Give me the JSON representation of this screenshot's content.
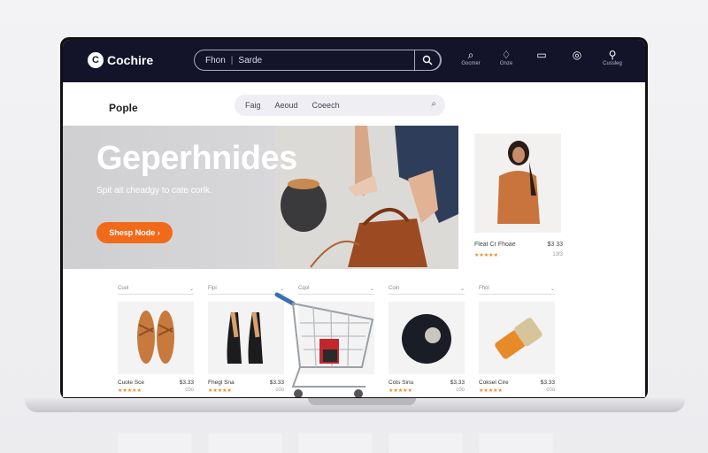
{
  "topbar": {
    "logo_text": "Cochire",
    "search_left": "Fhon",
    "search_right": "Sarde",
    "icons": [
      {
        "glyph": "⌕",
        "label": "Gocmer",
        "name": "search-icon"
      },
      {
        "glyph": "♢",
        "label": "Gnze",
        "name": "wishlist-icon"
      },
      {
        "glyph": "▭",
        "label": "",
        "name": "cart-icon"
      },
      {
        "glyph": "◎",
        "label": "",
        "name": "account-icon"
      },
      {
        "glyph": "⚲",
        "label": "Cussleg",
        "name": "profile-icon"
      }
    ]
  },
  "subhead": {
    "brand": "Pople",
    "nav": [
      "Faig",
      "Aeoud",
      "Coeech"
    ]
  },
  "hero": {
    "title": "Geperhnides",
    "subtitle": "Spit ait cheadgy to cate corlk.",
    "button": "Shesp Node ›"
  },
  "side_product": {
    "name": "Fleat Cr Fhoae",
    "price": "$3 33",
    "stars": "★★★★★",
    "count": "13f3"
  },
  "products": [
    {
      "header": "Cuol",
      "name": "Cuole Sce",
      "price": "$3.33",
      "stars": "★★★★★",
      "count": "c0o"
    },
    {
      "header": "Fipl",
      "name": "Fhegl Sna",
      "price": "$3.33",
      "stars": "★★★★★",
      "count": "c0o"
    },
    {
      "header": "Cqol",
      "name": "",
      "price": "",
      "stars": "",
      "count": ""
    },
    {
      "header": "Coin",
      "name": "Cots Sinu",
      "price": "$3.33",
      "stars": "★★★★★",
      "count": "c0o"
    },
    {
      "header": "Fhol",
      "name": "Coksel Cire",
      "price": "$3.33",
      "stars": "★★★★★",
      "count": "c0o"
    }
  ],
  "colors": {
    "nav_bg": "#13142a",
    "accent": "#f06a1a",
    "star": "#f08a20"
  }
}
